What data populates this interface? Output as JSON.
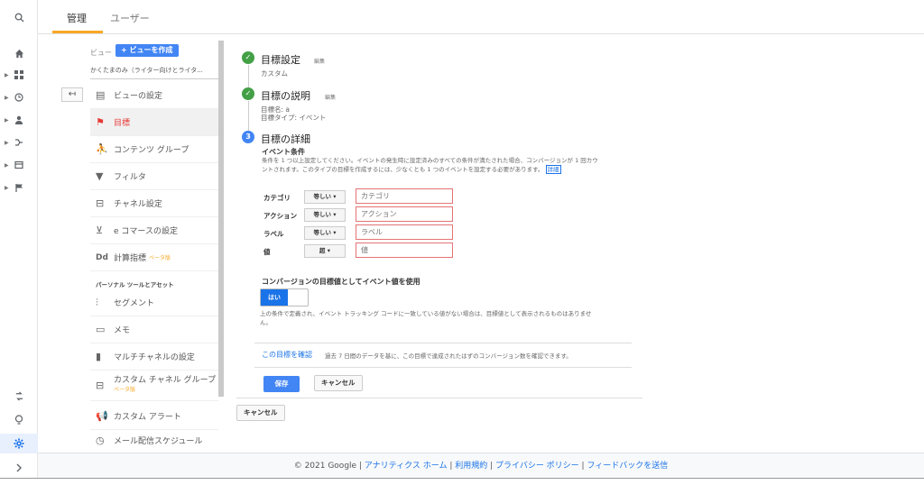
{
  "tabs": {
    "admin": "管理",
    "user": "ユーザー"
  },
  "rail": {
    "search": "search-icon",
    "home": "home-icon",
    "bottom": [
      "share-icon",
      "lightbulb-icon",
      "gear-icon",
      "chevron-right-icon"
    ]
  },
  "view": {
    "label": "ビュー",
    "create_button": "+ ビューを作成",
    "name": "かくたまのみ（ライター向けとライタ..."
  },
  "nav": {
    "view_settings": "ビューの設定",
    "goals": "目標",
    "content_grouping": "コンテンツ グループ",
    "filters": "フィルタ",
    "channel_settings": "チャネル設定",
    "ecommerce": "e コマースの設定",
    "calculated_metrics": "計算指標",
    "calculated_metrics_beta": "ベータ版",
    "section_personal": "パーソナル ツールとアセット",
    "segments": "セグメント",
    "annotations": "メモ",
    "multichannel": "マルチチャネルの設定",
    "custom_channel_group": "カスタム チャネル グループ",
    "custom_channel_group_beta": "ベータ版",
    "custom_alerts": "カスタム アラート",
    "email_schedule": "メール配信スケジュール"
  },
  "goal": {
    "step1": {
      "title": "目標設定",
      "edit": "編集",
      "sub": "カスタム"
    },
    "step2": {
      "title": "目標の説明",
      "edit": "編集",
      "sub1": "目標名: a",
      "sub2": "目標タイプ: イベント"
    },
    "step3": {
      "num": "3",
      "title": "目標の詳細"
    },
    "event_conditions_label": "イベント条件",
    "event_desc_1": "条件を 1 つ以上設定してください。イベントの発生時に設定済みのすべての条件が満たされた場合、コンバージョンが 1 回カウ",
    "event_desc_2": "ントされます。このタイプの目標を作成するには、少なくとも 1 つのイベントを設定する必要があります。",
    "details_link": "詳細",
    "conditions": [
      {
        "label": "カテゴリ",
        "operator": "等しい ▾",
        "placeholder": "カテゴリ"
      },
      {
        "label": "アクション",
        "operator": "等しい ▾",
        "placeholder": "アクション"
      },
      {
        "label": "ラベル",
        "operator": "等しい ▾",
        "placeholder": "ラベル"
      },
      {
        "label": "値",
        "operator": "超 ▾",
        "placeholder": "値"
      }
    ],
    "use_event_value_label": "コンバージョンの目標値としてイベント値を使用",
    "toggle_on": "はい",
    "toggle_desc_1": "上の条件で定義され、イベント トラッキング コードに一致している値がない場合は、目標値として表示されるものはありませ",
    "toggle_desc_2": "ん。",
    "verify_link": "この目標を確認",
    "verify_desc": "過去 7 日間のデータを基に、この目標で達成されたはずのコンバージョン数を確認できます。",
    "save_button": "保存",
    "cancel_button": "キャンセル",
    "outer_cancel_button": "キャンセル"
  },
  "footer": {
    "copyright": "© 2021 Google |",
    "analytics_home": "アナリティクス ホーム",
    "terms": "利用規約",
    "privacy": "プライバシー ポリシー",
    "feedback": "フィードバックを送信"
  }
}
